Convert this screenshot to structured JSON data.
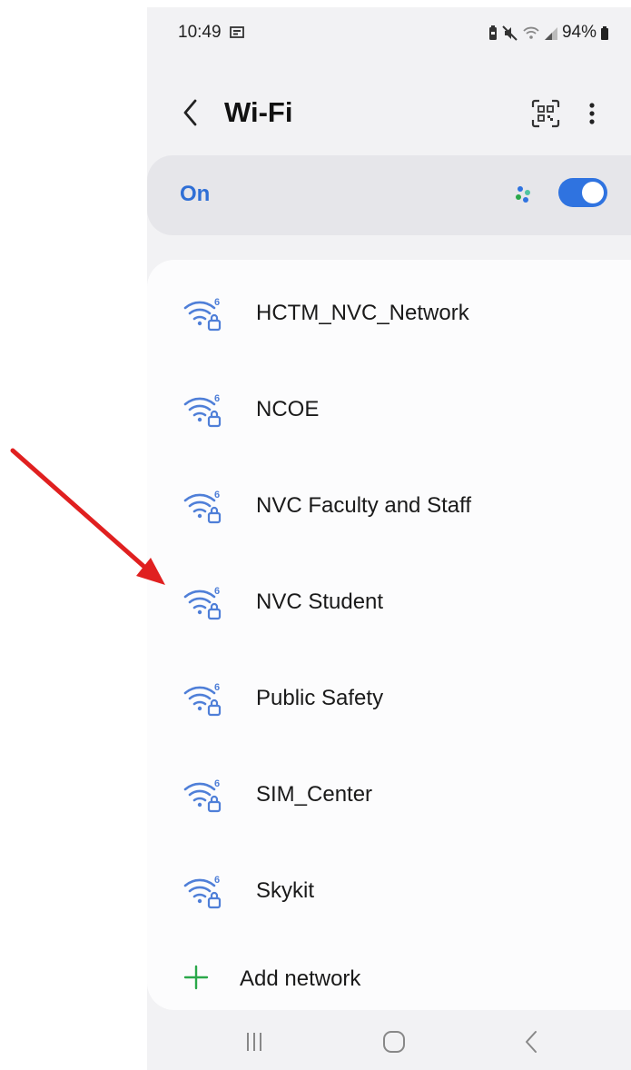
{
  "status_bar": {
    "time": "10:49",
    "battery": "94%"
  },
  "header": {
    "title": "Wi-Fi"
  },
  "wifi_toggle": {
    "label": "On",
    "state": "on"
  },
  "networks": [
    {
      "name": "HCTM_NVC_Network"
    },
    {
      "name": "NCOE"
    },
    {
      "name": "NVC Faculty and Staff"
    },
    {
      "name": "NVC Student"
    },
    {
      "name": "Public Safety"
    },
    {
      "name": "SIM_Center"
    },
    {
      "name": "Skykit"
    }
  ],
  "add_network": {
    "label": "Add network"
  },
  "colors": {
    "accent": "#2f73e0",
    "wifi_icon": "#4f7fd8",
    "plus": "#2aa84a",
    "annotation_arrow": "#e02020"
  },
  "icons": {
    "back": "chevron-left-icon",
    "qr": "qr-scan-icon",
    "more": "more-vert-icon",
    "network": "wifi-6-lock-icon",
    "add": "plus-icon"
  }
}
